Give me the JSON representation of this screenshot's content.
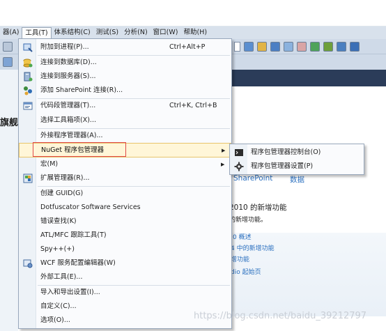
{
  "menubar": [
    {
      "label": "器(A)"
    },
    {
      "label": "工具(T)"
    },
    {
      "label": "体系结构(C)"
    },
    {
      "label": "测试(S)"
    },
    {
      "label": "分析(N)"
    },
    {
      "label": "窗口(W)"
    },
    {
      "label": "帮助(H)"
    }
  ],
  "background": {
    "left_heading": "旗舰",
    "sharepoint": "SharePoint",
    "data": "数据",
    "whats_new_title": "2010 的新增功能",
    "whats_new_sub": "的新增功能。",
    "link1": "0 概述",
    "link2": "4 中的新增功能",
    "link3": "增功能",
    "link4": "dio 起始页"
  },
  "tools_menu": {
    "items": [
      {
        "label": "附加到进程(P)...",
        "shortcut": "Ctrl+Alt+P",
        "icon": "attach-process-icon"
      },
      {
        "label": "连接到数据库(D)...",
        "icon": "connect-database-icon"
      },
      {
        "label": "连接到服务器(S)...",
        "icon": "connect-server-icon"
      },
      {
        "label": "添加 SharePoint 连接(R)...",
        "icon": "sharepoint-connection-icon"
      },
      {
        "label": "代码段管理器(T)...",
        "shortcut": "Ctrl+K, Ctrl+B",
        "icon": "snippet-manager-icon"
      },
      {
        "label": "选择工具箱项(X)..."
      },
      {
        "label": "外接程序管理器(A)..."
      },
      {
        "label": "NuGet 程序包管理器",
        "submenu": true
      },
      {
        "label": "宏(M)",
        "submenu": true
      },
      {
        "label": "扩展管理器(R)...",
        "icon": "extension-manager-icon"
      },
      {
        "label": "创建 GUID(G)"
      },
      {
        "label": "Dotfuscator Software Services"
      },
      {
        "label": "错误查找(K)"
      },
      {
        "label": "ATL/MFC 跟踪工具(T)"
      },
      {
        "label": "Spy++(+)"
      },
      {
        "label": "WCF 服务配置编辑器(W)",
        "icon": "wcf-config-icon"
      },
      {
        "label": "外部工具(E)..."
      },
      {
        "label": "导入和导出设置(I)..."
      },
      {
        "label": "自定义(C)..."
      },
      {
        "label": "选项(O)..."
      }
    ]
  },
  "nuget_submenu": {
    "items": [
      {
        "label": "程序包管理器控制台(O)",
        "icon": "console-icon"
      },
      {
        "label": "程序包管理器设置(P)",
        "icon": "settings-gear-icon"
      }
    ]
  },
  "watermark": "https://blog.csdn.net/baidu_39212797",
  "colors": {
    "menubar": "#d8e1ec",
    "highlight": "#fff6d8",
    "annotation": "#e04848",
    "dark_band": "#2b3c59"
  }
}
